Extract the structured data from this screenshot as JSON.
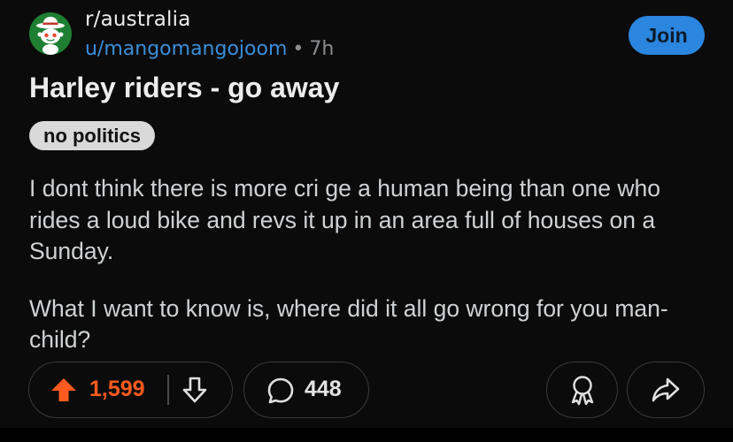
{
  "post": {
    "subreddit": "r/australia",
    "author": "u/mangomangojoom",
    "separator": "•",
    "age": "7h",
    "join_label": "Join",
    "title": "Harley riders - go away",
    "flair": "no politics",
    "body": [
      "I dont think there is more cri ge a human being than one who rides a loud bike and revs it up in an area full of houses on a Sunday.",
      "What I want to know is, where did it all go wrong for you man-child?"
    ]
  },
  "actions": {
    "score": "1,599",
    "comments": "448",
    "upvote_icon": "upvote-arrow-icon",
    "downvote_icon": "downvote-arrow-icon",
    "comment_icon": "speech-bubble-icon",
    "award_icon": "award-ribbon-icon",
    "share_icon": "share-arrow-icon"
  },
  "colors": {
    "background": "#0b0b0b",
    "join_button": "#2a86de",
    "author_link": "#3b8ed9",
    "upvote_active": "#ff5a1f",
    "flair_bg": "#d9d9d9",
    "avatar_bg": "#1e7f33"
  }
}
